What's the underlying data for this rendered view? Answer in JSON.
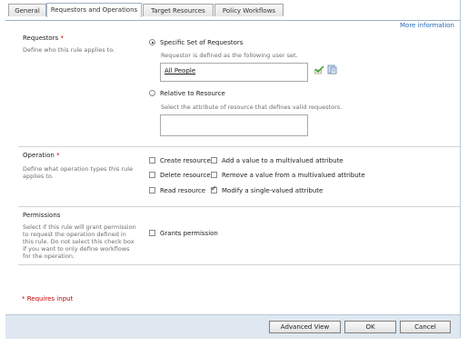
{
  "tabs": [
    "General",
    "Requestors and Operations",
    "Target Resources",
    "Policy Workflows"
  ],
  "more_info": "More information",
  "requestors": {
    "title": "Requestors",
    "required_mark": "*",
    "desc": "Define who this rule applies to.",
    "option_specific": "Specific Set of Requestors",
    "specific_desc": "Requestor is defined as the following user set.",
    "user_set_value": "All People",
    "option_relative": "Relative to Resource",
    "relative_desc": "Select the attribute of resource that defines valid requestors.",
    "selected": "specific"
  },
  "operation": {
    "title": "Operation",
    "required_mark": "*",
    "desc_line1": "Define what operation types this rule",
    "desc_line2": "applies to.",
    "checkboxes": [
      {
        "label": "Create resource",
        "checked": false
      },
      {
        "label": "Delete resource",
        "checked": false
      },
      {
        "label": "Read resource",
        "checked": false
      },
      {
        "label": "Add a value to a multivalued attribute",
        "checked": false
      },
      {
        "label": "Remove a value from a multivalued attribute",
        "checked": false
      },
      {
        "label": "Modify a single-valued attribute",
        "checked": true
      }
    ]
  },
  "permissions": {
    "title": "Permissions",
    "desc_lines": [
      "Select if this rule will grant permission",
      "to request the operation defined in",
      "this rule. Do not select this check box",
      "if you want to only define workflows",
      "for the operation."
    ],
    "grant_label": "Grants permission",
    "grant_checked": false
  },
  "requires_input": "* Requires input",
  "buttons": {
    "advanced": "Advanced View",
    "ok": "OK",
    "cancel": "Cancel"
  },
  "colors": {
    "required": "#cc0000",
    "link": "#2a6ab5",
    "footer": "#dfe8f1"
  }
}
